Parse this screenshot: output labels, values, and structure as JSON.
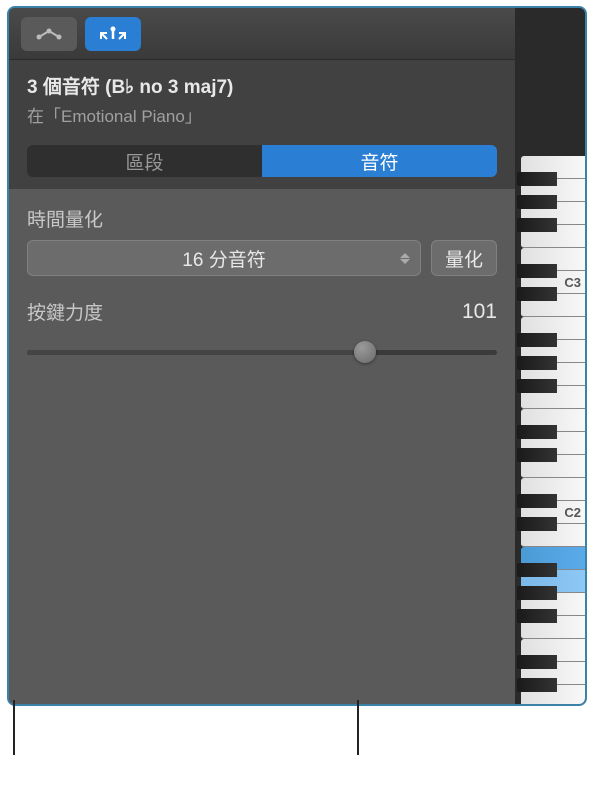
{
  "header": {
    "title": "3 個音符 (B♭ no 3 maj7)",
    "track_prefix": "在「",
    "track_name": "Emotional Piano",
    "track_suffix": "」"
  },
  "tabs": {
    "region": "區段",
    "notes": "音符"
  },
  "quantize": {
    "label": "時間量化",
    "value": "16 分音符",
    "button": "量化"
  },
  "velocity": {
    "label": "按鍵力度",
    "value": "101"
  },
  "piano": {
    "octave_labels": [
      "C3",
      "C2"
    ]
  }
}
